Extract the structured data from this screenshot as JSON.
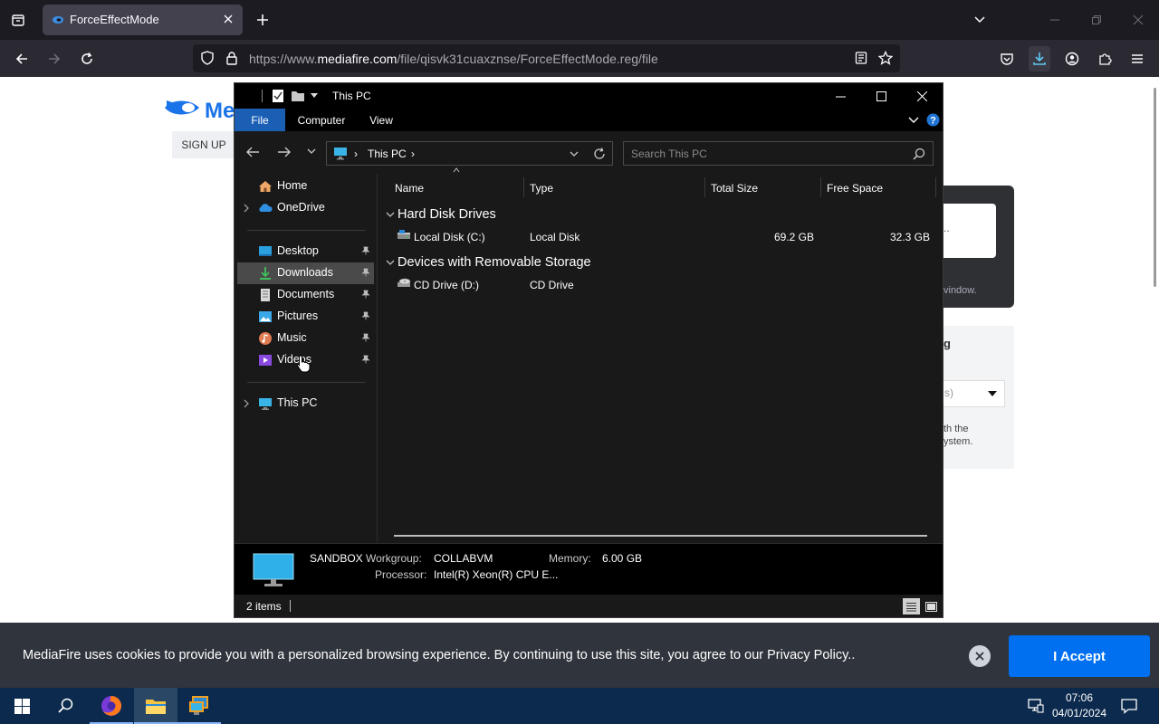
{
  "browser": {
    "tab_title": "ForceEffectMode",
    "url_prefix": "https://www.",
    "url_domain": "mediafire.com",
    "url_path": "/file/qisvk31cuaxznse/ForceEffectMode.reg/file"
  },
  "webpage": {
    "logo_text": "Me",
    "signup_label": "SIGN UP",
    "panel_dots": "..",
    "panel_window_text": "vindow.",
    "info_heading": "g",
    "info_select_value": "s)",
    "info_line1": "th the",
    "info_line2": "ystem."
  },
  "explorer": {
    "title": "This PC",
    "ribbon_tabs": [
      "File",
      "Computer",
      "View"
    ],
    "address_label": "This PC",
    "search_placeholder": "Search This PC",
    "nav": {
      "home": "Home",
      "onedrive": "OneDrive",
      "desktop": "Desktop",
      "downloads": "Downloads",
      "documents": "Documents",
      "pictures": "Pictures",
      "music": "Music",
      "videos": "Videos",
      "thispc": "This PC"
    },
    "columns": [
      "Name",
      "Type",
      "Total Size",
      "Free Space"
    ],
    "groups": [
      {
        "name": "Hard Disk Drives",
        "items": [
          {
            "name": "Local Disk (C:)",
            "type": "Local Disk",
            "total": "69.2 GB",
            "free": "32.3 GB"
          }
        ]
      },
      {
        "name": "Devices with Removable Storage",
        "items": [
          {
            "name": "CD Drive (D:)",
            "type": "CD Drive",
            "total": "",
            "free": ""
          }
        ]
      }
    ],
    "details": {
      "computer_name": "SANDBOX",
      "workgroup_label": "Workgroup:",
      "workgroup_value": "COLLABVM",
      "memory_label": "Memory:",
      "memory_value": "6.00 GB",
      "processor_label": "Processor:",
      "processor_value": "Intel(R) Xeon(R) CPU E..."
    },
    "status": "2 items"
  },
  "cookie": {
    "text": "MediaFire uses cookies to provide you with a personalized browsing experience. By continuing to use this site, you agree to our Privacy Policy..",
    "accept_label": "I Accept"
  },
  "taskbar": {
    "time": "07:06",
    "date": "04/01/2024"
  },
  "colors": {
    "accent_blue": "#1a5fb4",
    "accept_button": "#0070f0",
    "taskbar": "#0c2a4d"
  }
}
